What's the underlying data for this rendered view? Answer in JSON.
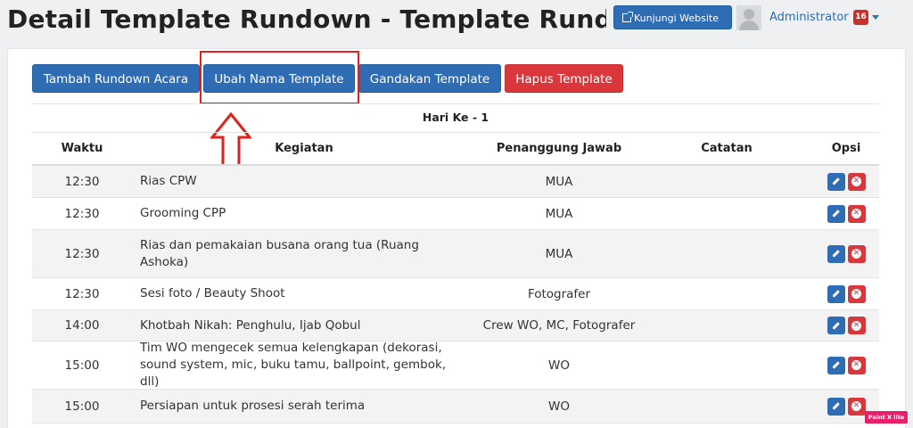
{
  "header": {
    "title": "Detail Template Rundown - Template Rundown",
    "visit_label": "Kunjungi Website",
    "user_name": "Administrator",
    "notification_count": "16"
  },
  "toolbar": {
    "add_label": "Tambah Rundown Acara",
    "rename_label": "Ubah Nama Template",
    "duplicate_label": "Gandakan Template",
    "delete_label": "Hapus Template"
  },
  "schedule": {
    "day_title": "Hari Ke - 1",
    "columns": {
      "time": "Waktu",
      "activity": "Kegiatan",
      "pic": "Penanggung Jawab",
      "notes": "Catatan",
      "options": "Opsi"
    },
    "rows": [
      {
        "time": "12:30",
        "activity": "Rias CPW",
        "pic": "MUA",
        "notes": ""
      },
      {
        "time": "12:30",
        "activity": "Grooming CPP",
        "pic": "MUA",
        "notes": ""
      },
      {
        "time": "12:30",
        "activity": "Rias dan pemakaian busana orang tua (Ruang Ashoka)",
        "pic": "MUA",
        "notes": ""
      },
      {
        "time": "12:30",
        "activity": "Sesi foto / Beauty Shoot",
        "pic": "Fotografer",
        "notes": ""
      },
      {
        "time": "14:00",
        "activity": "Khotbah Nikah: Penghulu, Ijab Qobul",
        "pic": "Crew WO, MC, Fotografer",
        "notes": ""
      },
      {
        "time": "15:00",
        "activity": "Tim WO mengecek semua kelengkapan (dekorasi, sound system, mic, buku tamu, ballpoint, gembok, dll)",
        "pic": "WO",
        "notes": ""
      },
      {
        "time": "15:00",
        "activity": "Persiapan untuk prosesi serah terima",
        "pic": "WO",
        "notes": ""
      }
    ]
  },
  "overlay_badge": "Paint X lite",
  "colors": {
    "primary": "#2e6db4",
    "danger": "#d9373c",
    "highlight": "#e32019",
    "background": "#eef0f2"
  },
  "icons": {
    "visit": "external-link-icon",
    "edit": "pencil-icon",
    "delete": "times-circle-icon",
    "menu": "chevron-down-icon"
  }
}
